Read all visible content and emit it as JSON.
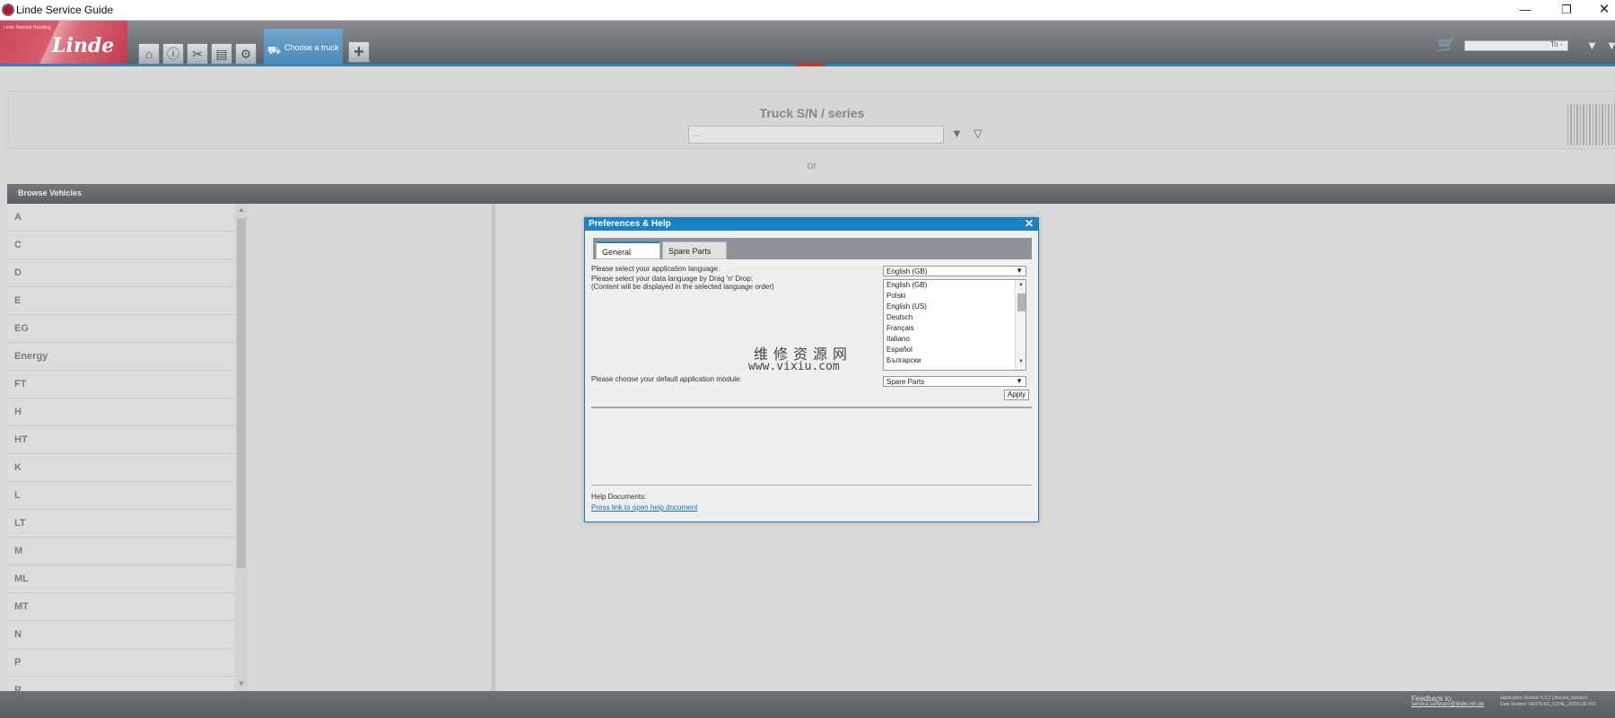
{
  "window": {
    "title": "Linde Service Guide",
    "minimize": "—",
    "maximize": "❐",
    "close": "✕"
  },
  "header": {
    "logo_small_text": "Linde Material Handling",
    "logo_text": "Linde",
    "tab_choose_truck": "Choose a truck",
    "add_tab": "+",
    "search_suffix": "To -",
    "icons": {
      "home": "home-icon",
      "info": "info-icon",
      "tools": "tools-icon",
      "truck": "truck-icon",
      "settings": "gear-icon",
      "cart": "cart-icon",
      "filter": "filter-icon"
    }
  },
  "search": {
    "label": "Truck S/N / series",
    "placeholder": "...",
    "or": "or"
  },
  "browse": {
    "title": "Browse Vehicles",
    "series": [
      "A",
      "C",
      "D",
      "E",
      "EG",
      "Energy",
      "FT",
      "H",
      "HT",
      "K",
      "L",
      "LT",
      "M",
      "ML",
      "MT",
      "N",
      "P",
      "R"
    ]
  },
  "dialog": {
    "title": "Preferences & Help",
    "close": "✕",
    "tabs": [
      "General",
      "Spare Parts"
    ],
    "app_language_label": "Please select your application language:",
    "app_language_value": "English (GB)",
    "data_language_label": "Please select your data language by Drag 'n' Drop:",
    "data_language_note": "(Content will be displayed in the selected language order)",
    "data_languages": [
      "English (GB)",
      "Polski",
      "English (US)",
      "Deutsch",
      "Français",
      "Italiano",
      "Español",
      "Български"
    ],
    "module_label": "Please choose your default application module:",
    "module_value": "Spare Parts",
    "apply": "Apply",
    "help_label": "Help Documents:",
    "help_link": "Press link to open help document"
  },
  "watermark": {
    "chinese": "维修资源网",
    "url": "www.vixiu.com"
  },
  "footer": {
    "feedback_label": "Feedback to:",
    "feedback_link": "service.software@linde-mh.de",
    "app_version": "Application Version: 5.3.2 [Jenkins_release]",
    "data_version": "Data Version: UE07/LSG_CCHE_20201130 002"
  },
  "colors": {
    "accent": "#1a82c4",
    "brand": "#c9475a",
    "header": "#5e6166"
  }
}
